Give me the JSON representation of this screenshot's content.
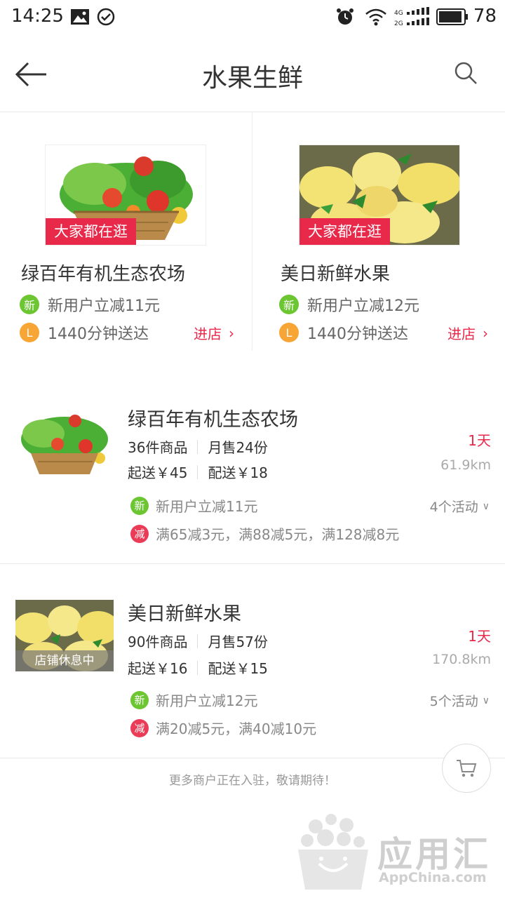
{
  "status_bar": {
    "time": "14:25",
    "battery": "78",
    "network": "4G 2G"
  },
  "header": {
    "title": "水果生鲜"
  },
  "featured": [
    {
      "tag": "大家都在逛",
      "name": "绿百年有机生态农场",
      "promo_badge": "新",
      "promo": "新用户立减11元",
      "delivery_badge": "L",
      "delivery": "1440分钟送达",
      "enter": "进店"
    },
    {
      "tag": "大家都在逛",
      "name": "美日新鲜水果",
      "promo_badge": "新",
      "promo": "新用户立减12元",
      "delivery_badge": "L",
      "delivery": "1440分钟送达",
      "enter": "进店"
    }
  ],
  "stores": [
    {
      "name": "绿百年有机生态农场",
      "goods": "36件商品",
      "monthly": "月售24份",
      "min_order": "起送￥45",
      "delivery_fee": "配送￥18",
      "days": "1天",
      "distance": "61.9km",
      "activity_new_badge": "新",
      "activity_new": "新用户立减11元",
      "activity_minus_badge": "减",
      "activity_minus": "满65减3元，满88减5元，满128减8元",
      "activity_count": "4个活动"
    },
    {
      "name": "美日新鲜水果",
      "goods": "90件商品",
      "monthly": "月售57份",
      "min_order": "起送￥16",
      "delivery_fee": "配送￥15",
      "days": "1天",
      "distance": "170.8km",
      "status_tag": "店铺休息中",
      "activity_new_badge": "新",
      "activity_new": "新用户立减12元",
      "activity_minus_badge": "减",
      "activity_minus": "满20减5元，满40减10元",
      "activity_count": "5个活动"
    }
  ],
  "footer_note": "更多商户正在入驻，敬请期待！",
  "watermark": {
    "text": "应用汇",
    "sub": "AppChina.com"
  },
  "colors": {
    "accent_red": "#e8294a",
    "new_green": "#6cc632",
    "clock_orange": "#f7a534"
  },
  "icons": [
    "back-arrow-icon",
    "search-icon",
    "cart-icon",
    "chevron-right-icon",
    "chevron-down-icon"
  ]
}
